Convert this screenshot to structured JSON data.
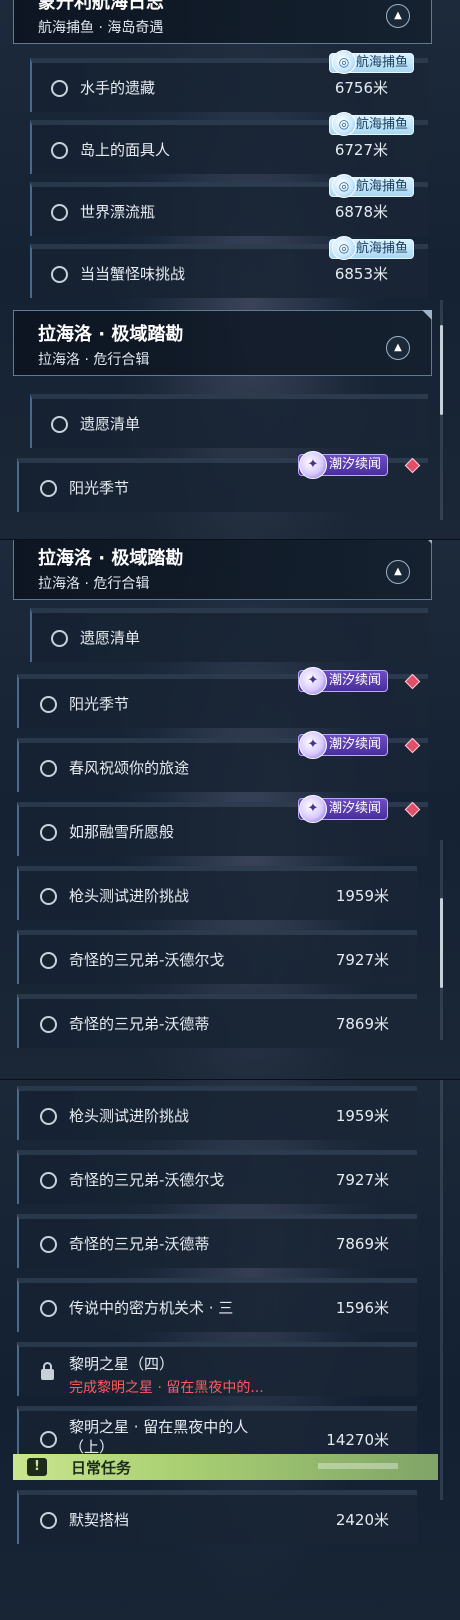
{
  "panel1": {
    "partial_header": {
      "title": "蒙升利航海日志",
      "subtitle": "航海捕鱼 · 海岛奇遇"
    },
    "rows": [
      {
        "name": "水手的遗藏",
        "distance": "6756米",
        "tag": "航海捕鱼"
      },
      {
        "name": "岛上的面具人",
        "distance": "6727米",
        "tag": "航海捕鱼"
      },
      {
        "name": "世界漂流瓶",
        "distance": "6878米",
        "tag": "航海捕鱼"
      },
      {
        "name": "当当蟹怪味挑战",
        "distance": "6853米",
        "tag": "航海捕鱼"
      }
    ],
    "header": {
      "title": "拉海洛 · 极域踏勘",
      "subtitle": "拉海洛 · 危行合辑"
    },
    "rows2": [
      {
        "name": "遗愿清单"
      },
      {
        "name": "阳光季节",
        "tag": "潮汐续闻"
      }
    ]
  },
  "panel2": {
    "header": {
      "title": "拉海洛 · 极域踏勘",
      "subtitle": "拉海洛 · 危行合辑"
    },
    "rows": [
      {
        "name": "遗愿清单"
      },
      {
        "name": "阳光季节",
        "tag": "潮汐续闻"
      },
      {
        "name": "春风祝颂你的旅途",
        "tag": "潮汐续闻"
      },
      {
        "name": "如那融雪所愿般",
        "tag": "潮汐续闻"
      },
      {
        "name": "枪头测试进阶挑战",
        "distance": "1959米"
      },
      {
        "name": "奇怪的三兄弟-沃德尔戈",
        "distance": "7927米"
      },
      {
        "name": "奇怪的三兄弟-沃德蒂",
        "distance": "7869米"
      }
    ]
  },
  "panel3": {
    "rows": [
      {
        "name": "枪头测试进阶挑战",
        "distance": "1959米"
      },
      {
        "name": "奇怪的三兄弟-沃德尔戈",
        "distance": "7927米"
      },
      {
        "name": "奇怪的三兄弟-沃德蒂",
        "distance": "7869米"
      },
      {
        "name": "传说中的密方机关术 · 三",
        "distance": "1596米"
      }
    ],
    "locked": {
      "name": "黎明之星（四）",
      "requirement": "完成黎明之星 · 留在黑夜中的..."
    },
    "two_line": {
      "name_line1": "黎明之星 · 留在黑夜中的人",
      "name_line2": "（上）",
      "distance": "14270米"
    },
    "daily": {
      "icon": "!",
      "label": "日常任务"
    },
    "daily_row": {
      "name": "默契搭档",
      "distance": "2420米"
    }
  },
  "icons": {
    "fish_tag": "fish-badge-icon",
    "tide_tag": "tide-badge-icon",
    "collapse": "chevron-up-icon",
    "lock": "lock-icon",
    "alert": "exclamation-icon"
  },
  "colors": {
    "fish_tag_bg": "#bfe3f7",
    "tide_tag_bg": "#5a3cb0",
    "diamond": "#e0506a",
    "locked_req": "#ff5b5b",
    "daily_bar": "#b6d97d"
  }
}
